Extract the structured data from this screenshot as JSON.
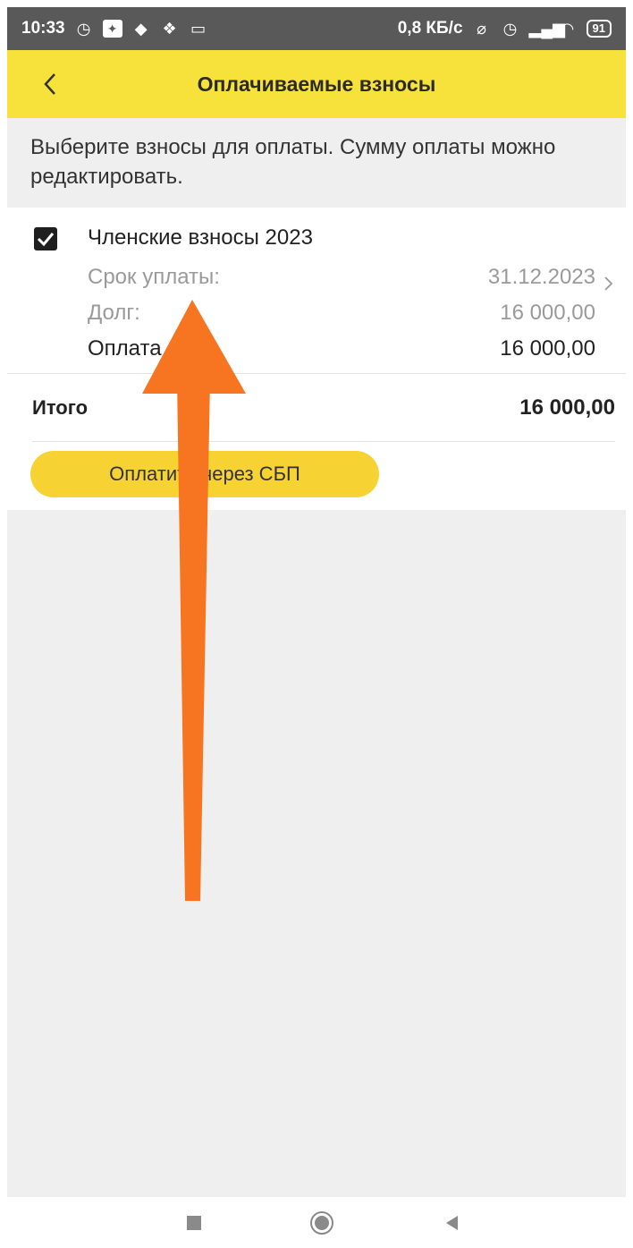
{
  "status_bar": {
    "time": "10:33",
    "left_icons": [
      "alarm-icon",
      "app-icon",
      "vpn-icon",
      "colorful-app-icon",
      "laptop-icon"
    ],
    "network_speed": "0,8 КБ/с",
    "right_icons": [
      "no-ring-icon",
      "alarm-icon",
      "signal-icon",
      "wifi-icon"
    ],
    "battery": "91"
  },
  "app_bar": {
    "title": "Оплачиваемые взносы",
    "back_icon": "chevron-left-icon",
    "background_color": "#f7e23b"
  },
  "hint_text": "Выберите взносы для оплаты. Сумму оплаты можно редактировать.",
  "items": [
    {
      "checked": true,
      "title": "Членские взносы 2023",
      "due_label": "Срок уплаты:",
      "due_value": "31.12.2023",
      "debt_label": "Долг:",
      "debt_value": "16 000,00",
      "payment_label": "Оплата",
      "payment_value": "16 000,00"
    }
  ],
  "total": {
    "label": "Итого",
    "value": "16 000,00"
  },
  "pay_button": {
    "label": "Оплатить через СБП",
    "color": "#f6d232"
  },
  "overlay": {
    "annotation": "up-arrow",
    "color": "#f77421"
  },
  "nav_bar": {
    "buttons": [
      "recent-apps-icon",
      "home-icon",
      "back-icon"
    ]
  }
}
